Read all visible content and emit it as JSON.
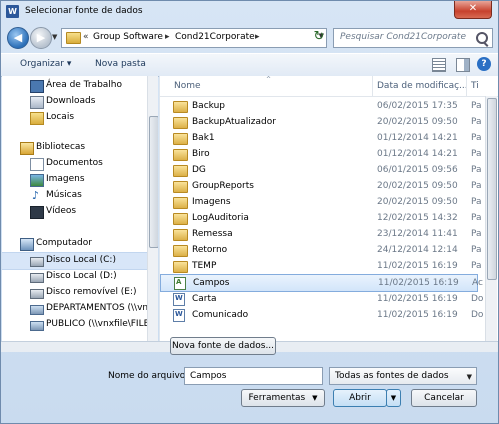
{
  "window": {
    "title": "Selecionar fonte de dados",
    "app_icon_letter": "W",
    "close_glyph": "✕"
  },
  "nav": {
    "back_glyph": "◀",
    "forward_glyph": "▶",
    "history_glyph": "▼",
    "address_prefix": "«",
    "address_parts": [
      "Group Software",
      "Cond21Corporate"
    ],
    "separator_glyph": "▸",
    "address_drop_glyph": "▼",
    "refresh_glyph": "↻",
    "search_placeholder": "Pesquisar Cond21Corporate"
  },
  "toolbar": {
    "organize": "Organizar ▾",
    "new_folder": "Nova pasta",
    "help_glyph": "?"
  },
  "sidebar": {
    "items": [
      {
        "label": "Área de Trabalho",
        "icon": "desktop-icon"
      },
      {
        "label": "Downloads",
        "icon": "downloads-icon"
      },
      {
        "label": "Locais",
        "icon": "places-icon"
      },
      {
        "label": "Bibliotecas",
        "icon": "libraries-icon"
      },
      {
        "label": "Documentos",
        "icon": "documents-icon"
      },
      {
        "label": "Imagens",
        "icon": "pictures-icon"
      },
      {
        "label": "Músicas",
        "icon": "music-icon",
        "glyph": "♪"
      },
      {
        "label": "Vídeos",
        "icon": "videos-icon"
      },
      {
        "label": "Computador",
        "icon": "computer-icon"
      },
      {
        "label": "Disco Local (C:)",
        "icon": "drive-icon"
      },
      {
        "label": "Disco Local (D:)",
        "icon": "drive-icon"
      },
      {
        "label": "Disco removível (E:)",
        "icon": "removable-drive-icon"
      },
      {
        "label": "DEPARTAMENTOS (\\\\vn",
        "icon": "network-drive-icon"
      },
      {
        "label": "PUBLICO (\\\\vnxfile\\FILES",
        "icon": "network-drive-icon"
      }
    ]
  },
  "columns": {
    "name": "Nome",
    "date": "Data de modificaç...",
    "type": "Ti",
    "sort_glyph": "^"
  },
  "files": [
    {
      "name": "Backup",
      "date": "06/02/2015 17:35",
      "type": "Pa",
      "icon": "folder-icon"
    },
    {
      "name": "BackupAtualizador",
      "date": "20/02/2015 09:50",
      "type": "Pa",
      "icon": "folder-icon"
    },
    {
      "name": "Bak1",
      "date": "01/12/2014 14:21",
      "type": "Pa",
      "icon": "folder-icon"
    },
    {
      "name": "Biro",
      "date": "01/12/2014 14:21",
      "type": "Pa",
      "icon": "folder-icon"
    },
    {
      "name": "DG",
      "date": "06/01/2015 09:56",
      "type": "Pa",
      "icon": "folder-icon"
    },
    {
      "name": "GroupReports",
      "date": "20/02/2015 09:50",
      "type": "Pa",
      "icon": "folder-icon"
    },
    {
      "name": "Imagens",
      "date": "20/02/2015 09:50",
      "type": "Pa",
      "icon": "folder-icon"
    },
    {
      "name": "LogAuditoria",
      "date": "12/02/2015 14:32",
      "type": "Pa",
      "icon": "folder-icon"
    },
    {
      "name": "Remessa",
      "date": "23/12/2014 11:41",
      "type": "Pa",
      "icon": "folder-icon"
    },
    {
      "name": "Retorno",
      "date": "24/12/2014 12:14",
      "type": "Pa",
      "icon": "folder-icon"
    },
    {
      "name": "TEMP",
      "date": "11/02/2015 16:19",
      "type": "Pa",
      "icon": "folder-icon"
    },
    {
      "name": "Campos",
      "date": "11/02/2015 16:19",
      "type": "Ac",
      "icon": "access-file-icon",
      "selected": true
    },
    {
      "name": "Carta",
      "date": "11/02/2015 16:19",
      "type": "Do",
      "icon": "word-doc-icon"
    },
    {
      "name": "Comunicado",
      "date": "11/02/2015 16:19",
      "type": "Do",
      "icon": "word-doc-icon"
    }
  ],
  "footer": {
    "new_source_button": "Nova fonte de dados...",
    "filename_label": "Nome do arquivo:",
    "filename_value": "Campos",
    "filter_value": "Todas as fontes de dados",
    "tools_button": "Ferramentas",
    "open_button": "Abrir",
    "cancel_button": "Cancelar",
    "dropdown_glyph": "▼"
  }
}
